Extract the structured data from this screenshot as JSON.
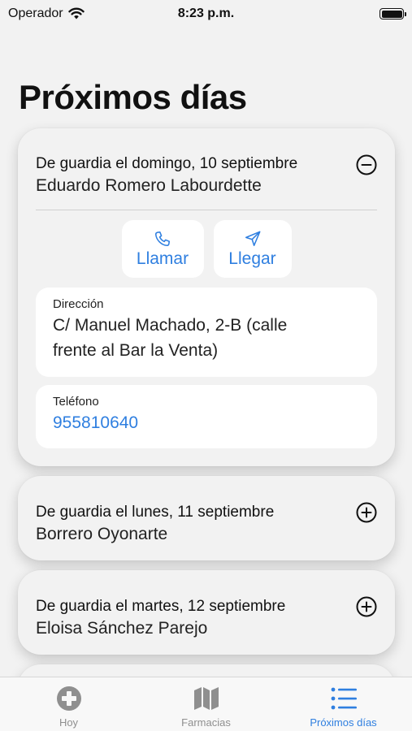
{
  "status_bar": {
    "carrier": "Operador",
    "time": "8:23 p.m."
  },
  "page": {
    "title": "Próximos días"
  },
  "cards": [
    {
      "day": "De guardia el domingo, 10 septiembre",
      "name": "Eduardo Romero Labourdette",
      "expanded": true,
      "toggle_icon": "minus-circle-icon",
      "actions": {
        "call_label": "Llamar",
        "arrive_label": "Llegar"
      },
      "address": {
        "label": "Dirección",
        "line1": "C/ Manuel Machado, 2-B (calle",
        "line2": "frente al Bar la Venta)"
      },
      "phone": {
        "label": "Teléfono",
        "value": "955810640"
      }
    },
    {
      "day": "De guardia el lunes, 11 septiembre",
      "name": "Borrero Oyonarte",
      "expanded": false,
      "toggle_icon": "plus-circle-icon"
    },
    {
      "day": "De guardia el martes, 12 septiembre",
      "name": "Eloisa Sánchez Parejo",
      "expanded": false,
      "toggle_icon": "plus-circle-icon"
    }
  ],
  "tab_bar": {
    "tabs": [
      {
        "label": "Hoy",
        "icon": "medical-cross-icon",
        "active": false
      },
      {
        "label": "Farmacias",
        "icon": "map-icon",
        "active": false
      },
      {
        "label": "Próximos días",
        "icon": "list-icon",
        "active": true
      }
    ]
  },
  "colors": {
    "accent": "#2f7fe0",
    "background": "#f2f2f2",
    "inactive_tab": "#8f8f8f"
  }
}
